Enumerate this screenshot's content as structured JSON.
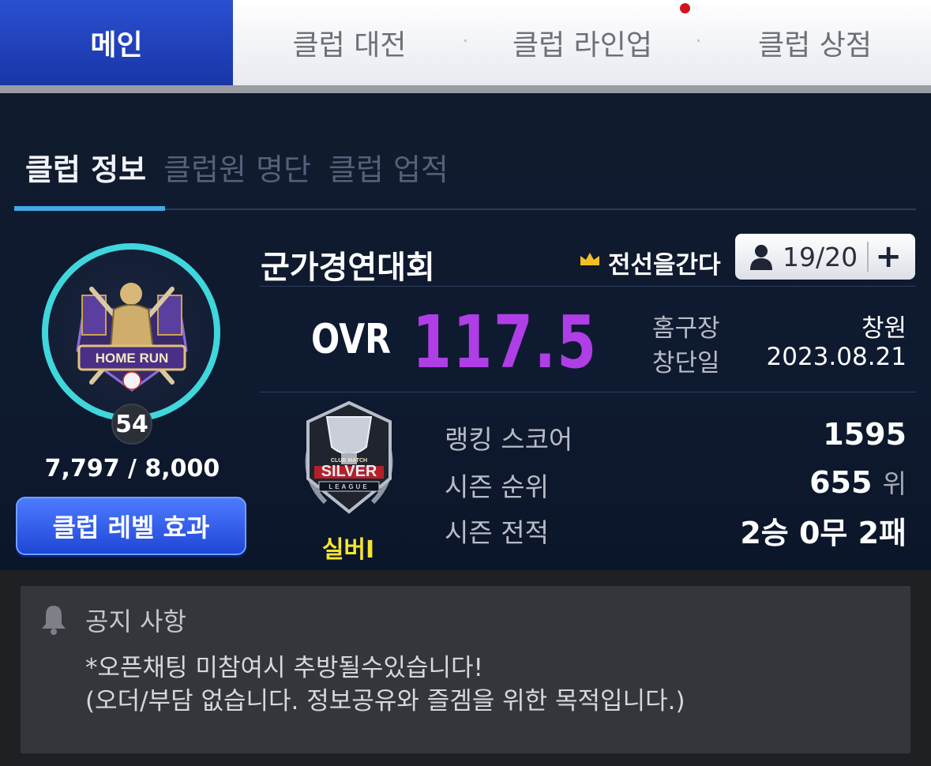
{
  "top_tabs": [
    {
      "label": "메인",
      "active": true
    },
    {
      "label": "클럽 대전",
      "active": false
    },
    {
      "label": "클럽 라인업",
      "active": false,
      "notification": true
    },
    {
      "label": "클럽 상점",
      "active": false
    }
  ],
  "sub_tabs": [
    {
      "label": "클럽 정보",
      "active": true
    },
    {
      "label": "클럽원 명단",
      "active": false
    },
    {
      "label": "클럽 업적",
      "active": false
    }
  ],
  "club": {
    "name": "군가경연대회",
    "leader": "전선을간다",
    "members": "19/20",
    "add_label": "+",
    "emblem_text": "HOME RUN",
    "level": "54",
    "exp": "7,797 / 8,000",
    "level_effect_button": "클럽 레벨 효과",
    "ovr_label": "OVR",
    "ovr_value": "117.5",
    "home_label": "홈구장",
    "home_value": "창원",
    "founded_label": "창단일",
    "founded_value": "2023.08.21"
  },
  "league": {
    "emblem_top": "CLUB MATCH",
    "emblem_text": "SILVER",
    "emblem_sub": "LEAGUE",
    "name": "실버I"
  },
  "stats": {
    "ranking_label": "랭킹 스코어",
    "ranking_value": "1595",
    "rank_label": "시즌 순위",
    "rank_value": "655",
    "rank_unit": "위",
    "record_label": "시즌 전적",
    "record_value": "2승 0무 2패"
  },
  "notice": {
    "title": "공지 사항",
    "lines": [
      "*오픈채팅 미참여시 추방될수있습니다!",
      "(오더/부담 없습니다. 정보공유와 즐겜을 위한 목적입니다.)"
    ]
  },
  "colors": {
    "accent_blue": "#1f46d6",
    "tab_underline": "#45a9e6",
    "ovr": "#b03ee6",
    "league": "#f3e531",
    "emblem_ring": "#3fd6dc",
    "notification": "#d3121d"
  },
  "icons": [
    "crown-icon",
    "person-icon",
    "plus-icon",
    "bell-icon"
  ]
}
